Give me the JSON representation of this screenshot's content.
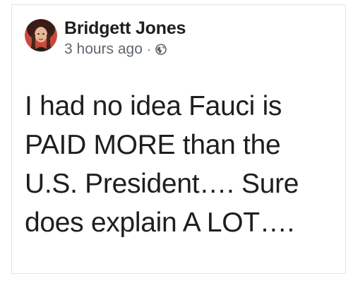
{
  "post": {
    "author": {
      "name": "Bridgett Jones",
      "avatar_icon": "profile-photo"
    },
    "meta": {
      "timestamp": "3 hours ago",
      "separator": "·",
      "audience_icon": "globe-icon"
    },
    "body_text": "I had no idea Fauci is\nPAID MORE than the\nU.S. President…. Sure\ndoes explain A LOT…."
  },
  "colors": {
    "text_primary": "#1c1e21",
    "text_secondary": "#606770",
    "card_border": "#e2e4e8",
    "background": "#ffffff"
  }
}
